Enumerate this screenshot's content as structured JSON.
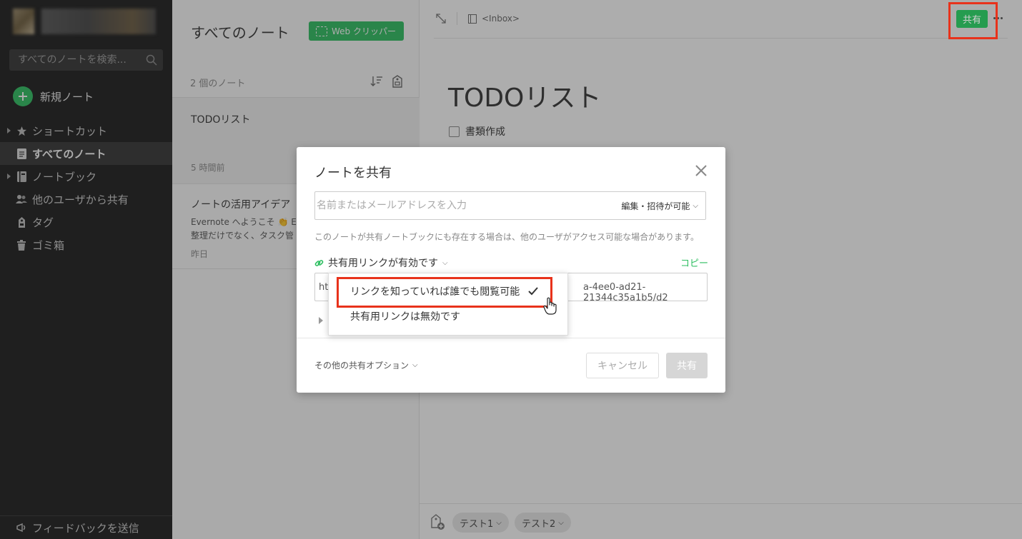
{
  "colors": {
    "accent": "#2dbe60",
    "highlight": "#e8321b",
    "sidebar_bg": "#1a1a1a"
  },
  "sidebar": {
    "search_placeholder": "すべてのノートを検索...",
    "new_note_label": "新規ノート",
    "items": [
      {
        "label": "ショートカット",
        "icon": "star-icon",
        "expandable": true
      },
      {
        "label": "すべてのノート",
        "icon": "note-icon",
        "active": true
      },
      {
        "label": "ノートブック",
        "icon": "notebook-icon",
        "expandable": true
      },
      {
        "label": "他のユーザから共有",
        "icon": "users-icon"
      },
      {
        "label": "タグ",
        "icon": "tag-icon"
      },
      {
        "label": "ゴミ箱",
        "icon": "trash-icon"
      }
    ],
    "feedback_label": "フィードバックを送信"
  },
  "note_list": {
    "title": "すべてのノート",
    "web_clipper_label": "Web クリッパー",
    "count_label": "2 個のノート",
    "notes": [
      {
        "title": "TODOリスト",
        "snippet": "",
        "time": "5 時間前"
      },
      {
        "title": "ノートの活用アイデア",
        "snippet": "Evernote へようこそ 👏 E",
        "snippet2": "整理だけでなく、タスク管",
        "time": "昨日"
      }
    ]
  },
  "editor": {
    "notebook_name": "<Inbox>",
    "share_label": "共有",
    "doc_title": "TODOリスト",
    "checklist": [
      {
        "label": "書類作成",
        "checked": false
      }
    ],
    "tags": [
      "テスト1",
      "テスト2"
    ]
  },
  "share_modal": {
    "title": "ノートを共有",
    "input_placeholder": "名前またはメールアドレスを入力",
    "permission_label": "編集・招待が可能",
    "notice": "このノートが共有ノートブックにも存在する場合は、他のユーザがアクセス可能な場合があります。",
    "link_status": "共有用リンクが有効です",
    "copy_label": "コピー",
    "url_prefix": "htt",
    "url_suffix": "a-4ee0-ad21-21344c35a1b5/d2",
    "more_options": "その他の共有オプション",
    "cancel_label": "キャンセル",
    "share_label": "共有"
  },
  "link_dropdown": {
    "options": [
      {
        "label": "リンクを知っていれば誰でも閲覧可能",
        "selected": true
      },
      {
        "label": "共有用リンクは無効です",
        "selected": false
      }
    ]
  }
}
